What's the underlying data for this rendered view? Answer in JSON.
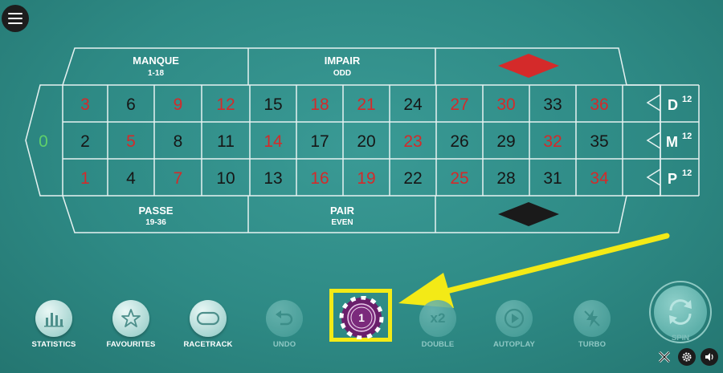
{
  "table": {
    "zero": "0",
    "rows": [
      [
        "3",
        "6",
        "9",
        "12",
        "15",
        "18",
        "21",
        "24",
        "27",
        "30",
        "33",
        "36"
      ],
      [
        "2",
        "5",
        "8",
        "11",
        "14",
        "17",
        "20",
        "23",
        "26",
        "29",
        "32",
        "35"
      ],
      [
        "1",
        "4",
        "7",
        "10",
        "13",
        "16",
        "19",
        "22",
        "25",
        "28",
        "31",
        "34"
      ]
    ],
    "red_numbers": [
      "1",
      "3",
      "5",
      "7",
      "9",
      "12",
      "14",
      "16",
      "18",
      "19",
      "21",
      "23",
      "25",
      "27",
      "30",
      "32",
      "34",
      "36"
    ],
    "colors": {
      "red": "#d42a2a",
      "black": "#161616",
      "zero": "#5fd06a",
      "line": "#e6f2f1"
    },
    "top_bets": [
      {
        "title": "MANQUE",
        "sub": "1-18"
      },
      {
        "title": "IMPAIR",
        "sub": "ODD"
      }
    ],
    "bottom_bets": [
      {
        "title": "PASSE",
        "sub": "19-36"
      },
      {
        "title": "PAIR",
        "sub": "EVEN"
      }
    ],
    "dozens": [
      {
        "letter": "D",
        "sup": "12"
      },
      {
        "letter": "M",
        "sup": "12"
      },
      {
        "letter": "P",
        "sup": "12"
      }
    ]
  },
  "controls": [
    {
      "label": "STATISTICS",
      "icon": "bar-chart-icon",
      "enabled": true
    },
    {
      "label": "FAVOURITES",
      "icon": "star-icon",
      "enabled": true
    },
    {
      "label": "RACETRACK",
      "icon": "racetrack-icon",
      "enabled": true
    },
    {
      "label": "UNDO",
      "icon": "undo-icon",
      "enabled": false
    },
    {
      "label": "DOUBLE",
      "icon": "double-icon",
      "enabled": false,
      "text": "x2"
    },
    {
      "label": "AUTOPLAY",
      "icon": "autoplay-icon",
      "enabled": false
    },
    {
      "label": "TURBO",
      "icon": "turbo-icon",
      "enabled": false
    }
  ],
  "chip": {
    "value": "1",
    "color": "#6a1f6b"
  },
  "spin": {
    "label": "SPIN"
  },
  "highlight_color": "#f3ea16"
}
